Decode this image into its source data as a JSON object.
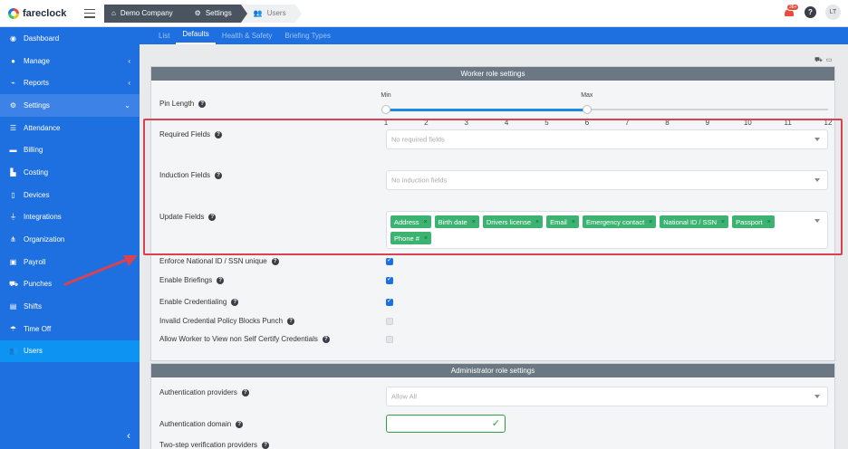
{
  "app": {
    "logo_text": "fareclock"
  },
  "breadcrumb": [
    {
      "label": "Demo Company",
      "icon": "home-icon"
    },
    {
      "label": "Settings",
      "icon": "gear-icon"
    },
    {
      "label": "Users",
      "icon": "users-icon"
    }
  ],
  "header": {
    "notification_count": "36+",
    "help_label": "?",
    "avatar_initials": "LT"
  },
  "sidebar": {
    "items": [
      {
        "label": "Dashboard",
        "icon": "gauge-icon",
        "chevron": ""
      },
      {
        "label": "Manage",
        "icon": "user-icon",
        "chevron": "‹"
      },
      {
        "label": "Reports",
        "icon": "chart-icon",
        "chevron": "‹"
      },
      {
        "label": "Settings",
        "icon": "gear-icon",
        "chevron": "⌄"
      },
      {
        "label": "Attendance",
        "icon": "attendance-icon",
        "chevron": ""
      },
      {
        "label": "Billing",
        "icon": "billing-icon",
        "chevron": ""
      },
      {
        "label": "Costing",
        "icon": "costing-icon",
        "chevron": ""
      },
      {
        "label": "Devices",
        "icon": "tablet-icon",
        "chevron": ""
      },
      {
        "label": "Integrations",
        "icon": "plug-icon",
        "chevron": ""
      },
      {
        "label": "Organization",
        "icon": "sitemap-icon",
        "chevron": ""
      },
      {
        "label": "Payroll",
        "icon": "payroll-icon",
        "chevron": ""
      },
      {
        "label": "Punches",
        "icon": "truck-icon",
        "chevron": ""
      },
      {
        "label": "Shifts",
        "icon": "shifts-icon",
        "chevron": ""
      },
      {
        "label": "Time Off",
        "icon": "beach-icon",
        "chevron": ""
      },
      {
        "label": "Users",
        "icon": "users-icon",
        "chevron": ""
      }
    ],
    "collapse_label": "‹"
  },
  "subtabs": [
    "List",
    "Defaults",
    "Health & Safety",
    "Briefing Types"
  ],
  "worker_panel": {
    "title": "Worker role settings",
    "pin_length": {
      "label": "Pin Length",
      "min_label": "Min",
      "max_label": "Max",
      "min_value": 1,
      "max_value": 6,
      "scale": [
        1,
        2,
        3,
        4,
        5,
        6,
        7,
        8,
        9,
        10,
        11,
        12
      ]
    },
    "required_fields": {
      "label": "Required Fields",
      "placeholder": "No required fields"
    },
    "induction_fields": {
      "label": "Induction Fields",
      "placeholder": "No induction fields"
    },
    "update_fields": {
      "label": "Update Fields",
      "tags": [
        "Address",
        "Birth date",
        "Drivers license",
        "Email",
        "Emergency contact",
        "National ID / SSN",
        "Passport",
        "Phone #"
      ]
    },
    "checkboxes": [
      {
        "label": "Enforce National ID / SSN unique",
        "checked": true
      },
      {
        "label": "Enable Briefings",
        "checked": true
      },
      {
        "label": "Enable Credentialing",
        "checked": true
      },
      {
        "label": "Invalid Credential Policy Blocks Punch",
        "checked": false
      },
      {
        "label": "Allow Worker to View non Self Certify Credentials",
        "checked": false
      }
    ]
  },
  "admin_panel": {
    "title": "Administrator role settings",
    "auth_providers": {
      "label": "Authentication providers",
      "placeholder": "Allow All"
    },
    "auth_domain": {
      "label": "Authentication domain",
      "value": ""
    },
    "two_step": {
      "label": "Two-step verification providers"
    }
  },
  "colors": {
    "sidebar": "#1e6fe0",
    "active_item": "#0d94f2",
    "tag": "#3cb371",
    "highlight": "#d9434f"
  }
}
